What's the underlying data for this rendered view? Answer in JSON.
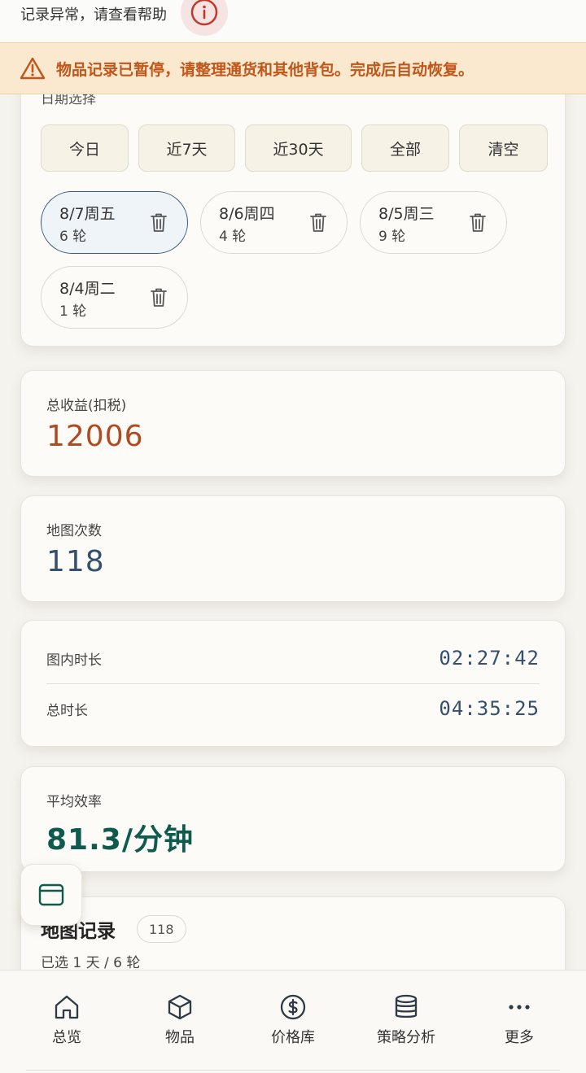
{
  "help": {
    "text": "记录异常，请查看帮助",
    "icon": "info-icon"
  },
  "warning": {
    "text": "物品记录已暂停，请整理通货和其他背包。完成后自动恢复。",
    "icon": "warning-icon",
    "color": "#c0561a"
  },
  "date_filter": {
    "title": "日期选择",
    "ranges": [
      "今日",
      "近7天",
      "近30天",
      "全部",
      "清空"
    ],
    "days": [
      {
        "date": "8/7周五",
        "rounds": "6 轮",
        "selected": true
      },
      {
        "date": "8/6周四",
        "rounds": "4 轮",
        "selected": false
      },
      {
        "date": "8/5周三",
        "rounds": "9 轮",
        "selected": false
      },
      {
        "date": "8/4周二",
        "rounds": "1 轮",
        "selected": false
      }
    ]
  },
  "stats": {
    "income_label": "总收益(扣税)",
    "income_value": "12006",
    "maps_label": "地图次数",
    "maps_value": "118",
    "in_map_label": "图内时长",
    "in_map_value": "02:27:42",
    "total_label": "总时长",
    "total_value": "04:35:25",
    "efficiency_label": "平均效率",
    "efficiency_value": "81.3/分钟"
  },
  "records": {
    "title": "地图记录",
    "count": "118",
    "subtitle": "已选 1 天 / 6 轮"
  },
  "nav": [
    {
      "label": "总览",
      "icon": "home-icon"
    },
    {
      "label": "物品",
      "icon": "box-icon"
    },
    {
      "label": "价格库",
      "icon": "dollar-icon"
    },
    {
      "label": "策略分析",
      "icon": "database-icon"
    },
    {
      "label": "更多",
      "icon": "more-icon"
    }
  ],
  "colors": {
    "income": "#b04a20",
    "count": "#33506e",
    "efficiency": "#0e5a4c",
    "selected_border": "#3e5a78"
  }
}
